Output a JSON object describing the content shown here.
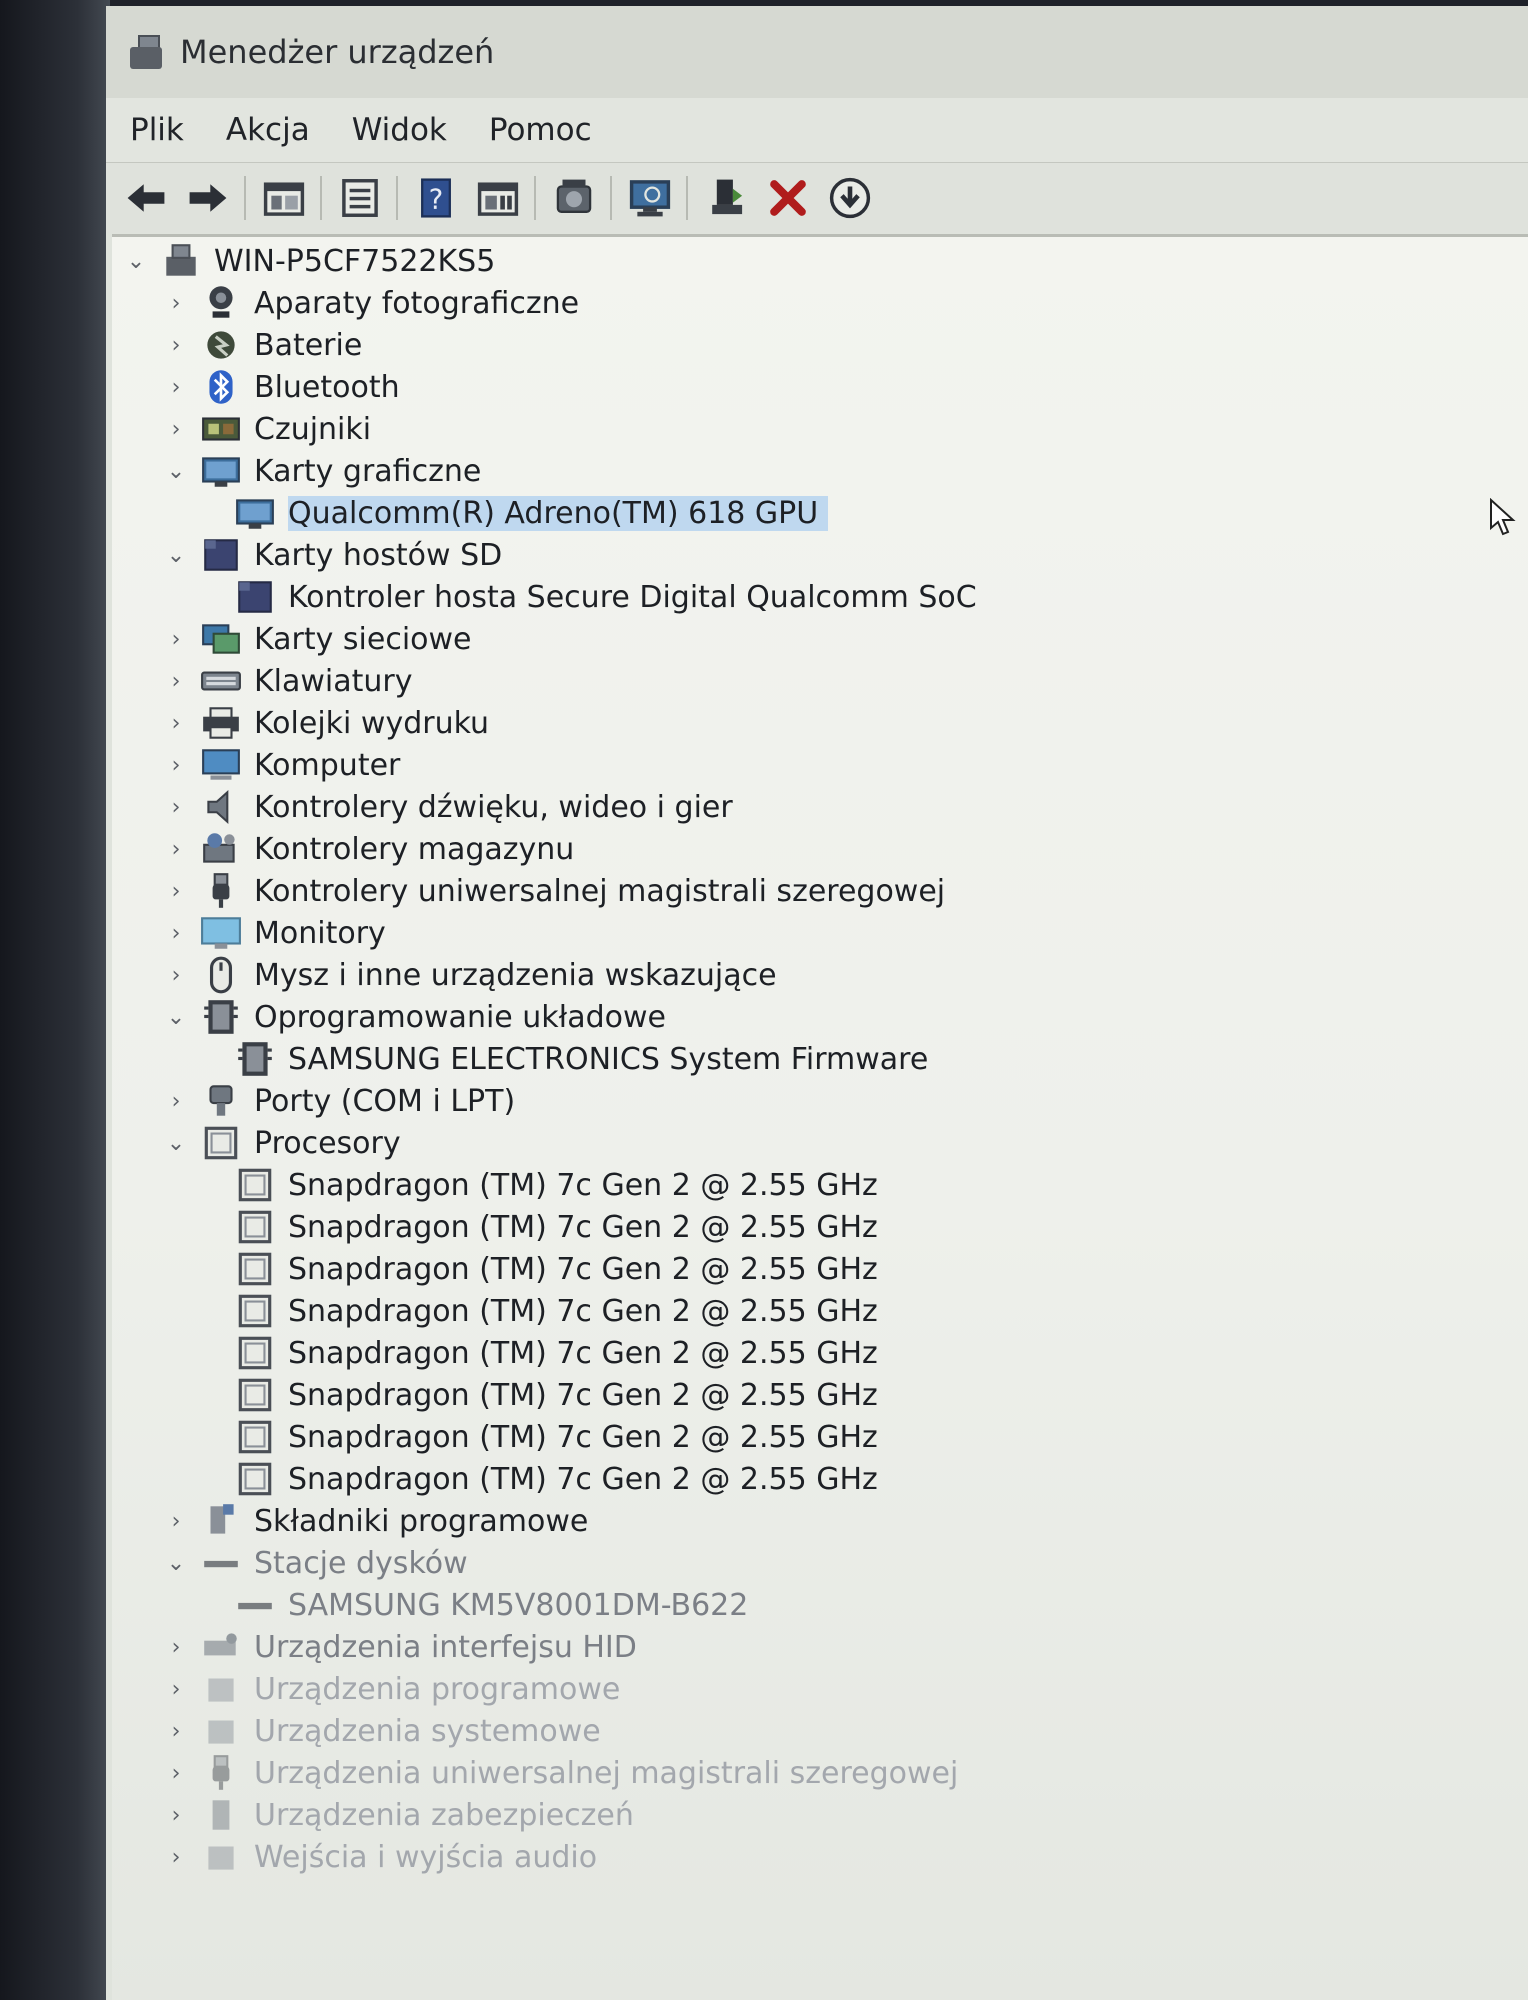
{
  "window": {
    "title": "Menedżer urządzeń"
  },
  "menu": [
    "Plik",
    "Akcja",
    "Widok",
    "Pomoc"
  ],
  "toolbar": {
    "buttons": [
      "back-icon",
      "forward-icon",
      "properties-pane-icon",
      "list-icon",
      "help-icon",
      "view-icon",
      "driver-update-icon",
      "scan-hardware-icon",
      "enable-device-icon",
      "uninstall-icon",
      "download-icon"
    ]
  },
  "tree": {
    "root": "WIN-P5CF7522KS5",
    "items": [
      {
        "label": "Aparaty fotograficzne",
        "icon": "camera-icon",
        "expanded": false
      },
      {
        "label": "Baterie",
        "icon": "battery-icon",
        "expanded": false
      },
      {
        "label": "Bluetooth",
        "icon": "bluetooth-icon",
        "expanded": false
      },
      {
        "label": "Czujniki",
        "icon": "sensor-icon",
        "expanded": false
      },
      {
        "label": "Karty graficzne",
        "icon": "display-adapter-icon",
        "expanded": true
      },
      {
        "label": "Qualcomm(R) Adreno(TM) 618 GPU",
        "icon": "display-adapter-icon",
        "child": true,
        "selected": true
      },
      {
        "label": "Karty hostów SD",
        "icon": "sd-host-icon",
        "expanded": true
      },
      {
        "label": "Kontroler hosta Secure Digital Qualcomm SoC",
        "icon": "sd-host-icon",
        "child": true
      },
      {
        "label": "Karty sieciowe",
        "icon": "network-icon",
        "expanded": false
      },
      {
        "label": "Klawiatury",
        "icon": "keyboard-icon",
        "expanded": false
      },
      {
        "label": "Kolejki wydruku",
        "icon": "printer-icon",
        "expanded": false
      },
      {
        "label": "Komputer",
        "icon": "computer-icon",
        "expanded": false
      },
      {
        "label": "Kontrolery dźwięku, wideo i gier",
        "icon": "speaker-icon",
        "expanded": false
      },
      {
        "label": "Kontrolery magazynu",
        "icon": "storage-controller-icon",
        "expanded": false
      },
      {
        "label": "Kontrolery uniwersalnej magistrali szeregowej",
        "icon": "usb-icon",
        "expanded": false
      },
      {
        "label": "Monitory",
        "icon": "monitor-icon",
        "expanded": false
      },
      {
        "label": "Mysz i inne urządzenia wskazujące",
        "icon": "mouse-icon",
        "expanded": false
      },
      {
        "label": "Oprogramowanie układowe",
        "icon": "firmware-icon",
        "expanded": true
      },
      {
        "label": "SAMSUNG ELECTRONICS System Firmware",
        "icon": "firmware-icon",
        "child": true
      },
      {
        "label": "Porty (COM i LPT)",
        "icon": "port-icon",
        "expanded": false
      },
      {
        "label": "Procesory",
        "icon": "processor-icon",
        "expanded": true
      },
      {
        "label": "Snapdragon (TM) 7c Gen 2 @ 2.55 GHz",
        "icon": "processor-icon",
        "child": true
      },
      {
        "label": "Snapdragon (TM) 7c Gen 2 @ 2.55 GHz",
        "icon": "processor-icon",
        "child": true
      },
      {
        "label": "Snapdragon (TM) 7c Gen 2 @ 2.55 GHz",
        "icon": "processor-icon",
        "child": true
      },
      {
        "label": "Snapdragon (TM) 7c Gen 2 @ 2.55 GHz",
        "icon": "processor-icon",
        "child": true
      },
      {
        "label": "Snapdragon (TM) 7c Gen 2 @ 2.55 GHz",
        "icon": "processor-icon",
        "child": true
      },
      {
        "label": "Snapdragon (TM) 7c Gen 2 @ 2.55 GHz",
        "icon": "processor-icon",
        "child": true
      },
      {
        "label": "Snapdragon (TM) 7c Gen 2 @ 2.55 GHz",
        "icon": "processor-icon",
        "child": true
      },
      {
        "label": "Snapdragon (TM) 7c Gen 2 @ 2.55 GHz",
        "icon": "processor-icon",
        "child": true
      },
      {
        "label": "Składniki programowe",
        "icon": "software-component-icon",
        "expanded": false
      },
      {
        "label": "Stacje dysków",
        "icon": "disk-drive-icon",
        "expanded": true
      },
      {
        "label": "SAMSUNG KM5V8001DM-B622",
        "icon": "disk-drive-icon",
        "child": true
      },
      {
        "label": "Urządzenia interfejsu HID",
        "icon": "hid-icon",
        "expanded": false
      },
      {
        "label": "Urządzenia programowe",
        "icon": "software-device-icon",
        "expanded": false
      },
      {
        "label": "Urządzenia systemowe",
        "icon": "system-device-icon",
        "expanded": false
      },
      {
        "label": "Urządzenia uniwersalnej magistrali szeregowej",
        "icon": "usb-icon",
        "expanded": false
      },
      {
        "label": "Urządzenia zabezpieczeń",
        "icon": "security-device-icon",
        "expanded": false
      },
      {
        "label": "Wejścia i wyjścia audio",
        "icon": "audio-io-icon",
        "expanded": false
      }
    ]
  },
  "colors": {
    "selection": "#bfd8ef",
    "window_bg": "#eef0eb",
    "text": "#1d2025"
  }
}
